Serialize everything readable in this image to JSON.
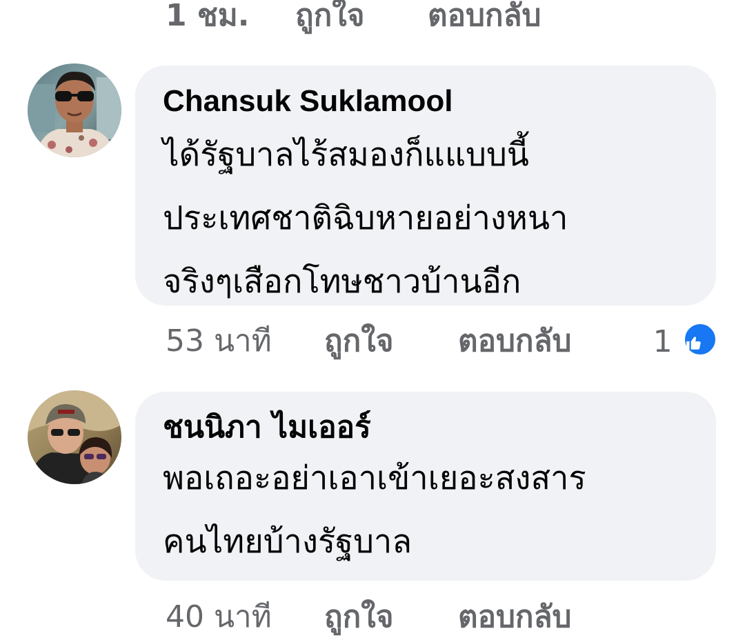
{
  "top_meta": {
    "time": "1 ชม.",
    "like_label": "ถูกใจ",
    "reply_label": "ตอบกลับ"
  },
  "comments": [
    {
      "author": "Chansuk Suklamool",
      "lines": [
        "ได้รัฐบาลไร้สมองก็แแบบนี้",
        "ประเทศชาติฉิบหายอย่างหนา",
        "จริงๆเสือกโทษชาวบ้านอีก"
      ],
      "time": "53 นาที",
      "like_label": "ถูกใจ",
      "reply_label": "ตอบกลับ",
      "reaction_count": "1",
      "reaction_icon": "like-thumb-icon",
      "reaction_color": "#1877f2"
    },
    {
      "author": "ชนนิภา ไมเออร์",
      "lines": [
        "พอเถอะอย่าเอาเข้าเยอะสงสาร",
        "คนไทยบ้างรัฐบาล"
      ],
      "time": "40 นาที",
      "like_label": "ถูกใจ",
      "reply_label": "ตอบกลับ"
    }
  ],
  "colors": {
    "bubble": "#f0f2f5",
    "meta_text": "#65676b",
    "body_text": "#050505",
    "like_blue": "#1877f2"
  }
}
